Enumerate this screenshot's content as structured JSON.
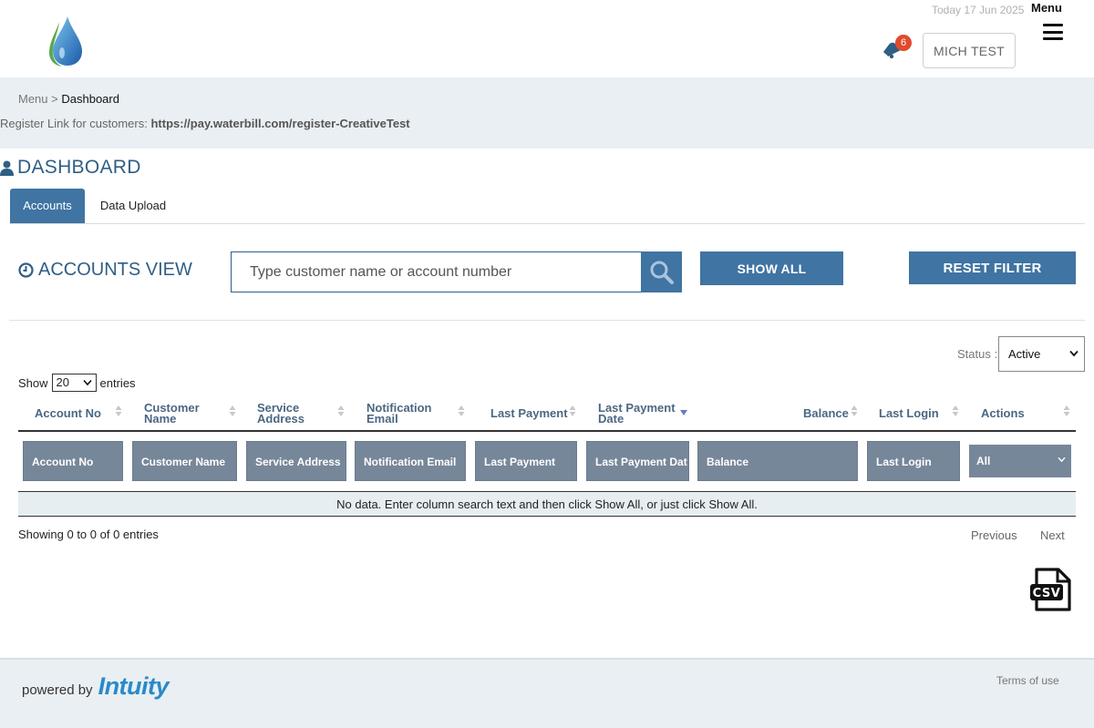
{
  "header": {
    "date": "Today 17 Jun 2025",
    "menu_label": "Menu",
    "notification_count": "6",
    "user_button": "MICH TEST"
  },
  "breadcrumb": {
    "root": "Menu",
    "separator": ">",
    "current": "Dashboard"
  },
  "register": {
    "label": "Register Link for customers:",
    "link": "https://pay.waterbill.com/register-CreativeTest"
  },
  "dashboard": {
    "title": "DASHBOARD"
  },
  "tabs": [
    {
      "label": "Accounts",
      "active": true
    },
    {
      "label": "Data Upload",
      "active": false
    }
  ],
  "accounts_view": {
    "title": "ACCOUNTS VIEW",
    "search_placeholder": "Type customer name or account number",
    "show_all": "SHOW ALL",
    "reset_filter": "RESET FILTER"
  },
  "status": {
    "label": "Status :",
    "value": "Active"
  },
  "entries": {
    "show": "Show",
    "value": "20",
    "suffix": "entries"
  },
  "table": {
    "columns": [
      "Account No",
      "Customer Name",
      "Service Address",
      "Notification Email",
      "Last Payment",
      "Last Payment Date",
      "Balance",
      "Last Login",
      "Actions"
    ],
    "filters": [
      "Account No",
      "Customer Name",
      "Service Address",
      "Notification Email",
      "Last Payment",
      "Last Payment Dat",
      "Balance",
      "Last Login"
    ],
    "actions_filter": "All",
    "no_data": "No data. Enter column search text and then click Show All, or just click Show All."
  },
  "pagination": {
    "info": "Showing 0 to 0 of 0 entries",
    "previous": "Previous",
    "next": "Next"
  },
  "footer": {
    "powered_by": "powered by",
    "brand": "Intuity",
    "terms": "Terms of use"
  },
  "colors": {
    "primary": "#3f74a3",
    "title": "#2f5e86",
    "band": "#e9eff3",
    "filter": "#77879a",
    "badge": "#e04b2e",
    "brand": "#2a8ac8"
  }
}
